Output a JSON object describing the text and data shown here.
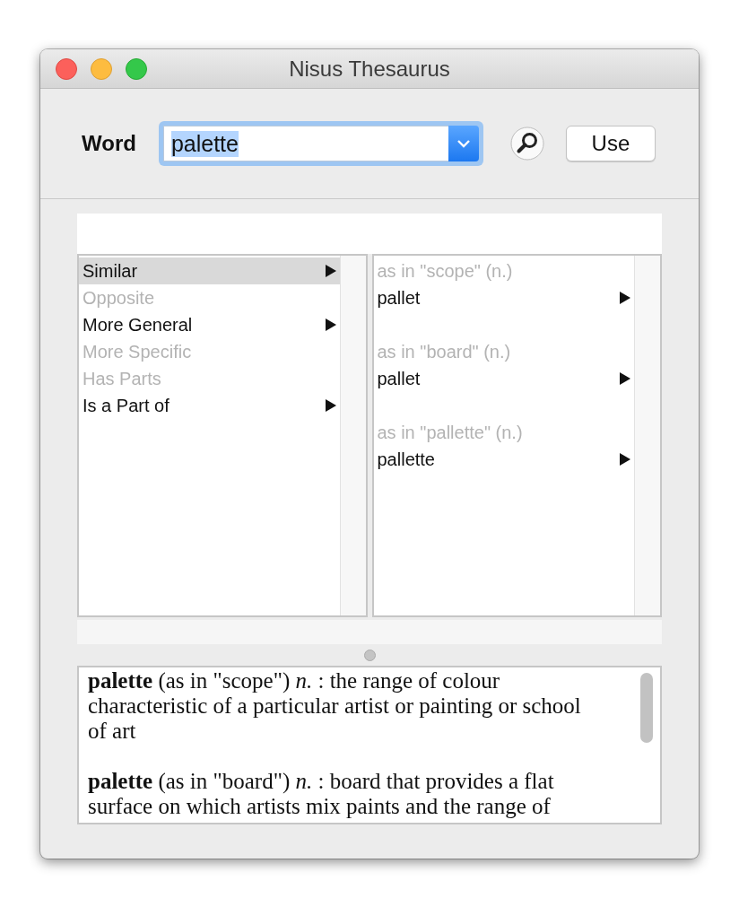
{
  "window": {
    "title": "Nisus Thesaurus"
  },
  "word_field": {
    "label": "Word",
    "value": "palette",
    "text_selected": true
  },
  "use_button": {
    "label": "Use"
  },
  "relations": [
    {
      "label": "Similar",
      "selected": true,
      "disabled": false,
      "has_submenu": true
    },
    {
      "label": "Opposite",
      "selected": false,
      "disabled": true,
      "has_submenu": false
    },
    {
      "label": "More General",
      "selected": false,
      "disabled": false,
      "has_submenu": true
    },
    {
      "label": "More Specific",
      "selected": false,
      "disabled": true,
      "has_submenu": false
    },
    {
      "label": "Has Parts",
      "selected": false,
      "disabled": true,
      "has_submenu": false
    },
    {
      "label": "Is a Part of",
      "selected": false,
      "disabled": false,
      "has_submenu": true
    }
  ],
  "results": [
    {
      "kind": "heading",
      "label": "as in \"scope\" (n.)"
    },
    {
      "kind": "entry",
      "label": "pallet",
      "has_submenu": true
    },
    {
      "kind": "spacer"
    },
    {
      "kind": "heading",
      "label": "as in \"board\" (n.)"
    },
    {
      "kind": "entry",
      "label": "pallet",
      "has_submenu": true
    },
    {
      "kind": "spacer"
    },
    {
      "kind": "heading",
      "label": "as in \"pallette\" (n.)"
    },
    {
      "kind": "entry",
      "label": "pallette",
      "has_submenu": true
    }
  ],
  "definitions": [
    "**palette** (as in \"scope\") *n.* : the range of colour characteristic of a particular artist or painting or school of art",
    "**palette** (as in \"board\") *n.* : board that provides a flat surface on which artists mix paints and the range of"
  ]
}
